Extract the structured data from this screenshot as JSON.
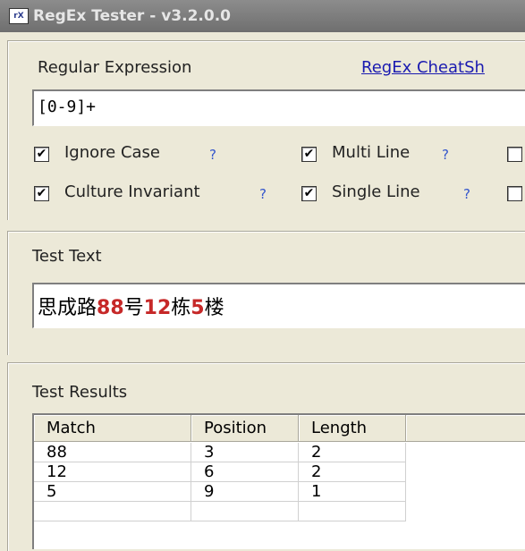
{
  "window": {
    "title": "RegEx Tester - v3.2.0.0",
    "icon": "rx-app-icon"
  },
  "regex": {
    "label": "Regular Expression",
    "cheatsheet_link": "RegEx CheatSh",
    "value": "[0-9]+"
  },
  "options": [
    {
      "label": "Ignore Case",
      "checked": true,
      "help": "?"
    },
    {
      "label": "Multi Line",
      "checked": true,
      "help": "?"
    },
    {
      "label": "Culture Invariant",
      "checked": true,
      "help": "?"
    },
    {
      "label": "Single Line",
      "checked": true,
      "help": "?"
    }
  ],
  "test_text": {
    "label": "Test Text",
    "segments": [
      {
        "text": "思成路",
        "match": false
      },
      {
        "text": "88",
        "match": true
      },
      {
        "text": "号",
        "match": false
      },
      {
        "text": "12",
        "match": true
      },
      {
        "text": "栋",
        "match": false
      },
      {
        "text": "5",
        "match": true
      },
      {
        "text": "楼",
        "match": false
      }
    ]
  },
  "results": {
    "label": "Test Results",
    "columns": [
      "Match",
      "Position",
      "Length"
    ],
    "rows": [
      [
        "88",
        "3",
        "2"
      ],
      [
        "12",
        "6",
        "2"
      ],
      [
        "5",
        "9",
        "1"
      ]
    ]
  }
}
